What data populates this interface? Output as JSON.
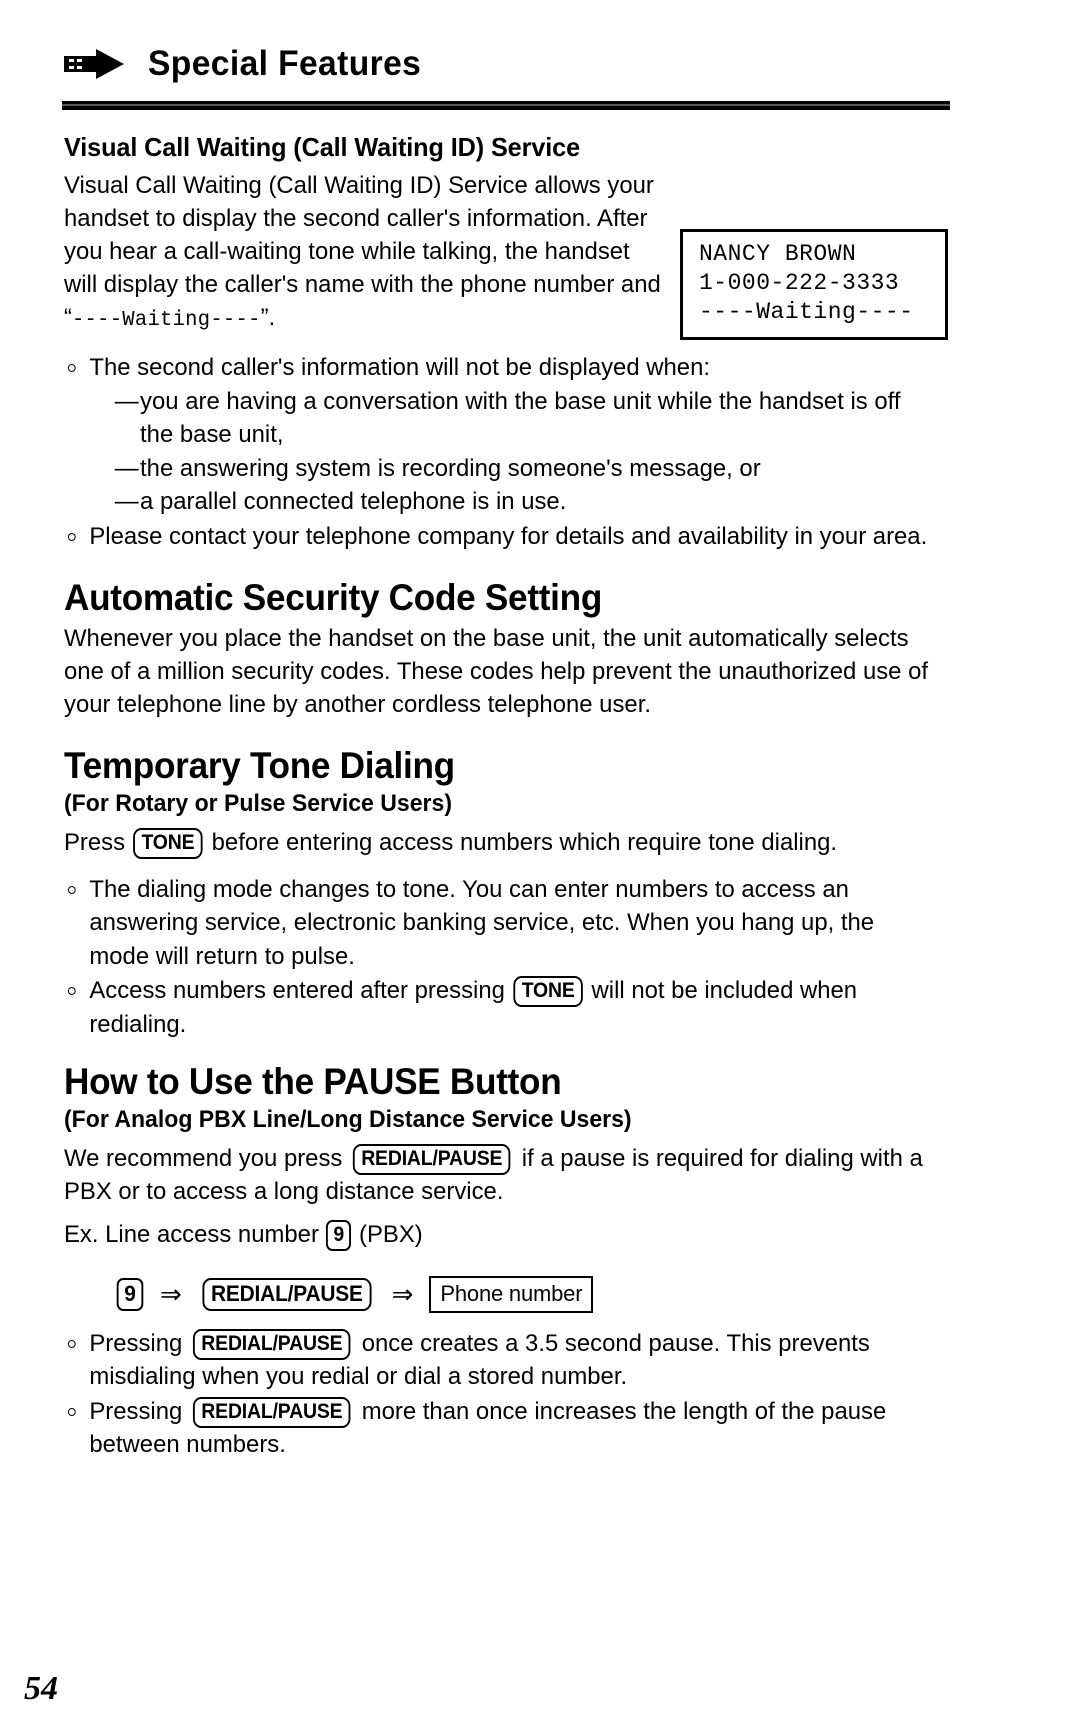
{
  "header": {
    "icon": "right-arrow-icon",
    "title": "Special Features"
  },
  "sections": {
    "visual_call_waiting": {
      "heading": "Visual Call Waiting (Call Waiting ID) Service",
      "intro_part1": "Visual Call Waiting (Call Waiting ID) Service allows your handset to display the second caller's information. After you hear a call-waiting tone while talking, the handset will display the caller's name with the phone number and “",
      "intro_mono": "----Waiting----",
      "intro_part2": "”.",
      "lcd": {
        "line1": "NANCY BROWN",
        "line2": "1-000-222-3333",
        "line3": "----Waiting----"
      },
      "bullet1": "The second caller's information will not be displayed when:",
      "sub_bullets": [
        "you are having a conversation with the base unit while the handset is off the base unit,",
        "the answering system is recording someone's message, or",
        "a parallel connected telephone is in use."
      ],
      "bullet2": "Please contact your telephone company for details and availability in your area."
    },
    "automatic_security": {
      "heading": "Automatic Security Code Setting",
      "body": "Whenever you place the handset on the base unit, the unit automatically selects one of a million security codes. These codes help prevent the unauthorized use of your telephone line by another cordless telephone user."
    },
    "temporary_tone": {
      "heading": "Temporary Tone Dialing",
      "subheading": "(For Rotary or Pulse Service Users)",
      "press_prefix": "Press",
      "tone_key": "TONE",
      "press_suffix": "before entering access numbers which require tone dialing.",
      "bullet1": "The dialing mode changes to tone. You can enter numbers to access an answering service, electronic banking service, etc. When you hang up, the mode will return to pulse.",
      "bullet2_prefix": "Access numbers entered after pressing",
      "bullet2_suffix": "will not be included when redialing."
    },
    "pause_button": {
      "heading": "How to Use the PAUSE Button",
      "subheading": "(For Analog PBX Line/Long Distance Service Users)",
      "recommend_prefix": "We recommend you press",
      "redial_key": "REDIAL/PAUSE",
      "recommend_suffix": "if a pause is required for dialing with a PBX or to access a long distance service.",
      "example_prefix": "Ex.  Line access number",
      "example_key": "9",
      "example_suffix": "(PBX)",
      "sequence": {
        "key1": "9",
        "arrow1": "⇒",
        "key2": "REDIAL/PAUSE",
        "arrow2": "⇒",
        "key3": "Phone number"
      },
      "bullet1_prefix": "Pressing",
      "bullet1_suffix": "once creates a 3.5 second pause. This prevents misdialing when you redial or dial a stored number.",
      "bullet2_prefix": "Pressing",
      "bullet2_suffix": "more than once increases the length of the pause between numbers."
    }
  },
  "footer": {
    "page_number": "54"
  }
}
